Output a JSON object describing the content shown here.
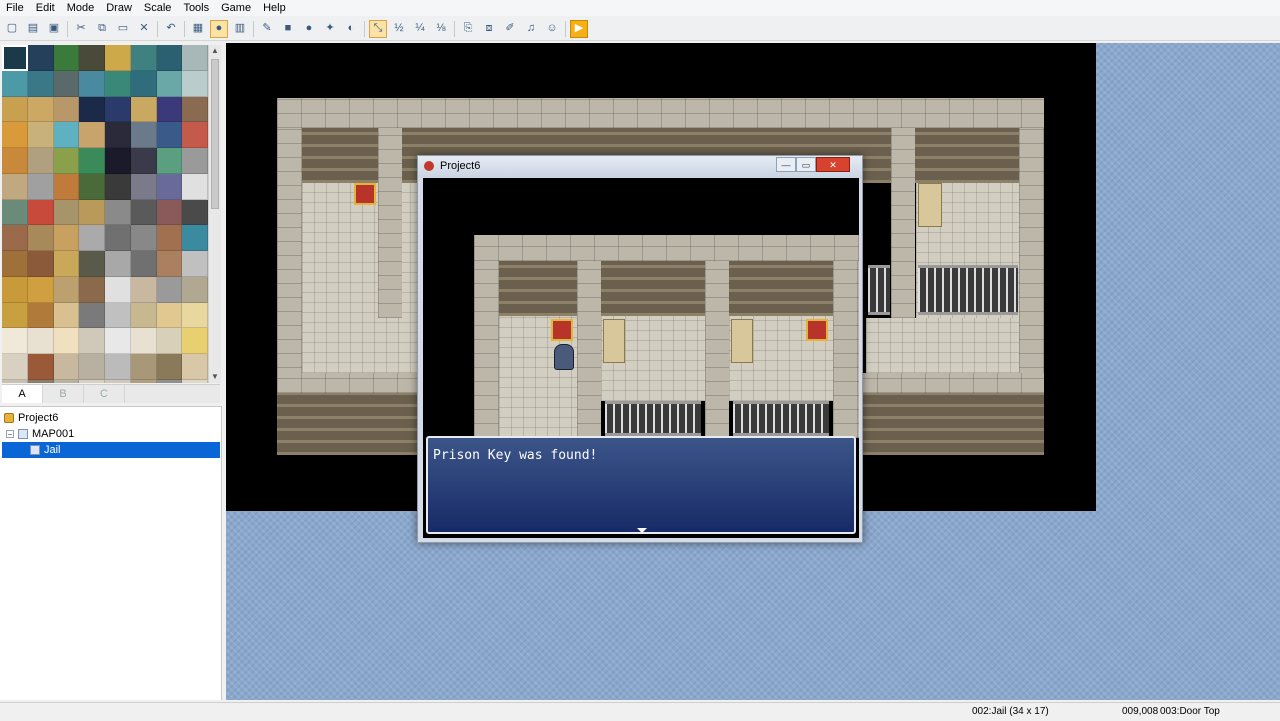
{
  "menubar": {
    "items": [
      "File",
      "Edit",
      "Mode",
      "Draw",
      "Scale",
      "Tools",
      "Game",
      "Help"
    ]
  },
  "toolbar": {
    "buttons": [
      {
        "name": "new-project-button",
        "glyph": "▢"
      },
      {
        "name": "open-project-button",
        "glyph": "▤"
      },
      {
        "name": "save-project-button",
        "glyph": "▣"
      },
      {
        "sep": true
      },
      {
        "name": "cut-button",
        "glyph": "✂"
      },
      {
        "name": "copy-button",
        "glyph": "⧉"
      },
      {
        "name": "paste-button",
        "glyph": "▭"
      },
      {
        "name": "delete-button",
        "glyph": "✕"
      },
      {
        "sep": true
      },
      {
        "name": "undo-button",
        "glyph": "↶"
      },
      {
        "sep": true
      },
      {
        "name": "map-mode-button",
        "glyph": "▦"
      },
      {
        "name": "event-mode-button",
        "glyph": "●",
        "pressed": true
      },
      {
        "name": "region-mode-button",
        "glyph": "▥"
      },
      {
        "sep": true
      },
      {
        "name": "pencil-tool-button",
        "glyph": "✎"
      },
      {
        "name": "rectangle-tool-button",
        "glyph": "■"
      },
      {
        "name": "ellipse-tool-button",
        "glyph": "●"
      },
      {
        "name": "flood-fill-button",
        "glyph": "✦"
      },
      {
        "name": "shadow-pen-button",
        "glyph": "◐"
      },
      {
        "sep": true
      },
      {
        "name": "zoom-1-1-button",
        "glyph": "⤡",
        "pressed": true
      },
      {
        "name": "zoom-1-2-button",
        "glyph": "½"
      },
      {
        "name": "zoom-1-4-button",
        "glyph": "¼"
      },
      {
        "name": "zoom-1-8-button",
        "glyph": "⅛"
      },
      {
        "sep": true
      },
      {
        "name": "database-button",
        "glyph": "⎘"
      },
      {
        "name": "resource-manager-button",
        "glyph": "⧈"
      },
      {
        "name": "script-editor-button",
        "glyph": "✐"
      },
      {
        "name": "sound-test-button",
        "glyph": "♫"
      },
      {
        "name": "character-generator-button",
        "glyph": "☺"
      },
      {
        "sep": true
      },
      {
        "name": "playtest-button",
        "glyph": "▶",
        "play": true
      }
    ]
  },
  "tileset": {
    "tabs": [
      "A",
      "B",
      "C"
    ],
    "active_tab": "A",
    "tile_colors": [
      "#1a3a4a",
      "#24405a",
      "#3a7a3a",
      "#4a4a3a",
      "#cda94a",
      "#3f8080",
      "#2a6070",
      "#a8b8b8",
      "#4c9aa8",
      "#3a7888",
      "#5a6a6a",
      "#4a8aa0",
      "#3a8878",
      "#2f6c7c",
      "#6aa8a8",
      "#bcc",
      "#c8a050",
      "#cda864",
      "#b89868",
      "#1c2a4a",
      "#2a3a6a",
      "#c9a861",
      "#3a3a7a",
      "#8a6a50",
      "#d89a3a",
      "#c9b27a",
      "#5fb0c0",
      "#c8a46c",
      "#2a2a3a",
      "#6a7a8a",
      "#3a5a8a",
      "#c45a4a",
      "#c88a3a",
      "#b0a080",
      "#8aa04a",
      "#3a8a5a",
      "#1a1a2a",
      "#3a3a4a",
      "#5aa080",
      "#9a9a9a",
      "#c0a880",
      "#a0a0a0",
      "#c07a3a",
      "#4a6a3a",
      "#3a3a3a",
      "#7a7a8a",
      "#6a6a9a",
      "#e0e0e0",
      "#6a8a7a",
      "#c84a3a",
      "#a8946a",
      "#ba9a5a",
      "#8a8a8a",
      "#5a5a5a",
      "#8a5a5a",
      "#4a4a4a",
      "#9a6a4a",
      "#a88a5a",
      "#c8a060",
      "#aaa",
      "#707070",
      "#888",
      "#a07050",
      "#3a8aa0",
      "#a0703a",
      "#8a5a3a",
      "#c9a85a",
      "#5a5a4a",
      "#a8a8a8",
      "#707070",
      "#aa8060",
      "#c0c0c0",
      "#c89a3a",
      "#d0a040",
      "#bca070",
      "#8a6a4a",
      "#e0e0e0",
      "#c8b8a0",
      "#9a9a9a",
      "#b0a890",
      "#c8a040",
      "#b07a3a",
      "#d8c090",
      "#7a7a7a",
      "#c0c0c0",
      "#c8b890",
      "#e0c890",
      "#e8d8a0",
      "#f0e8d8",
      "#e8e0d0",
      "#f0e0c0",
      "#d0c8b8",
      "#e8e8e8",
      "#e8e0d0",
      "#d8d0b8",
      "#e8d070",
      "#d8d0c0",
      "#9a5a3a",
      "#c8b8a0",
      "#b8b0a0",
      "#bbb",
      "#a89878",
      "#8a7a5a",
      "#d8c8a8",
      "#c8c0b0",
      "#8a8070",
      "#b8b0a0",
      "#d8d0c0",
      "#d0c8b8",
      "#b0a080",
      "#909090",
      "#e0d8c8",
      "#203060",
      "#e0e0e0",
      "#d8d8d8",
      "#f0f0f0",
      "#ffffff",
      "#e0e0e0",
      "#d0d0d0",
      "#c0c0c0"
    ]
  },
  "tree": {
    "project": "Project6",
    "map": "MAP001",
    "selected": "Jail",
    "expander": "−"
  },
  "game_window": {
    "title": "Project6",
    "minimize": "—",
    "maximize": "▭",
    "close": "✕",
    "message": "Prison Key was found!"
  },
  "status": {
    "map_info": "002:Jail (34 x 17)",
    "coords": "009,008",
    "tile_info": "003:Door Top"
  }
}
